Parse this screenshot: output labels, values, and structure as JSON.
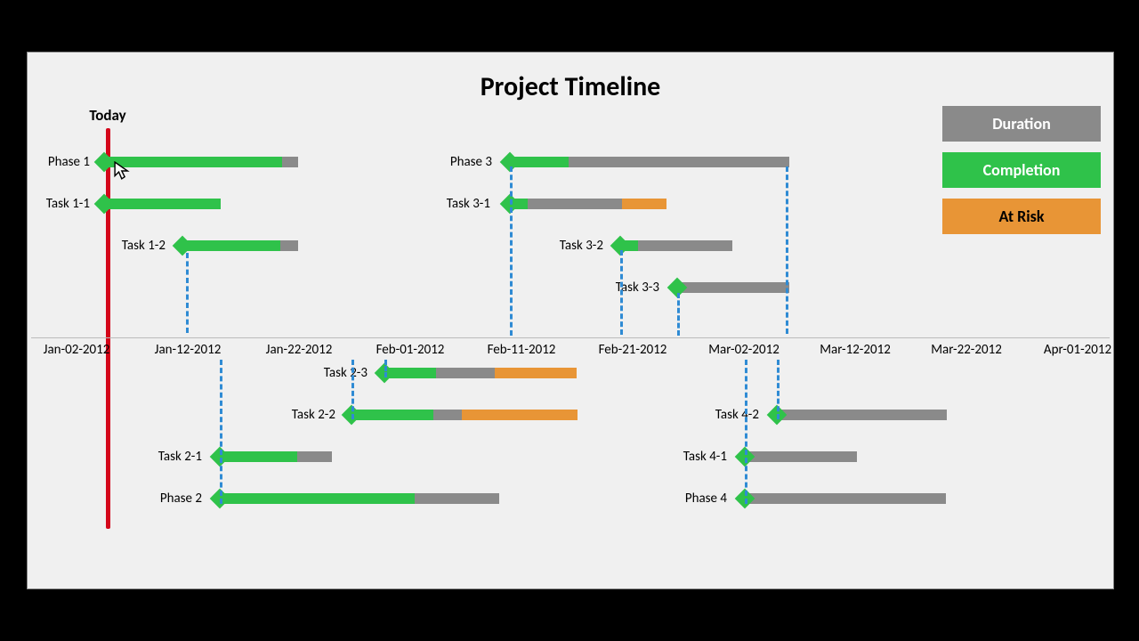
{
  "title": "Project Timeline",
  "today_label": "Today",
  "legend": {
    "duration": "Duration",
    "completion": "Completion",
    "risk": "At Risk"
  },
  "colors": {
    "duration": "#8a8a8a",
    "completion": "#2fc24a",
    "risk": "#e89536",
    "today": "#d4061a"
  },
  "chart_data": {
    "type": "gantt",
    "title": "Project Timeline",
    "x_axis": {
      "ticks": [
        "Jan-02-2012",
        "Jan-12-2012",
        "Jan-22-2012",
        "Feb-01-2012",
        "Feb-11-2012",
        "Feb-21-2012",
        "Mar-02-2012",
        "Mar-12-2012",
        "Mar-22-2012",
        "Apr-01-2012"
      ]
    },
    "today": "Jan-04-2012",
    "lanes": {
      "upper": [
        {
          "name": "Phase 1",
          "label": "Phase 1",
          "start": "Jan-04-2012",
          "end": "Jan-21-2012",
          "completion": 0.92,
          "risk": 0
        },
        {
          "name": "Task 1-1",
          "label": "Task 1-1",
          "start": "Jan-04-2012",
          "end": "Jan-14-2012",
          "completion": 1.0,
          "risk": 0
        },
        {
          "name": "Task 1-2",
          "label": "Task 1-2",
          "start": "Jan-11-2012",
          "end": "Jan-21-2012",
          "completion": 0.85,
          "risk": 0
        },
        {
          "name": "Phase 3",
          "label": "Phase 3",
          "start": "Feb-08-2012",
          "end": "Mar-04-2012",
          "completion": 0.22,
          "risk": 0
        },
        {
          "name": "Task 3-1",
          "label": "Task 3-1",
          "start": "Feb-08-2012",
          "end": "Feb-22-2012",
          "completion": 0.18,
          "risk": 0.82
        },
        {
          "name": "Task 3-2",
          "label": "Task 3-2",
          "start": "Feb-20-2012",
          "end": "Feb-29-2012",
          "completion": 0.18,
          "risk": 0
        },
        {
          "name": "Task 3-3",
          "label": "Task 3-3",
          "start": "Feb-25-2012",
          "end": "Mar-04-2012",
          "completion": 0,
          "risk": 0
        }
      ],
      "lower": [
        {
          "name": "Task 2-3",
          "label": "Task 2-3",
          "start": "Jan-29-2012",
          "end": "Feb-14-2012",
          "completion": 0.28,
          "risk": 0.72
        },
        {
          "name": "Task 2-2",
          "label": "Task 2-2",
          "start": "Jan-25-2012",
          "end": "Feb-14-2012",
          "completion": 0.35,
          "risk": 0.65
        },
        {
          "name": "Task 2-1",
          "label": "Task 2-1",
          "start": "Jan-14-2012",
          "end": "Jan-25-2012",
          "completion": 0.7,
          "risk": 0
        },
        {
          "name": "Phase 2",
          "label": "Phase 2",
          "start": "Jan-14-2012",
          "end": "Feb-08-2012",
          "completion": 0.7,
          "risk": 0
        },
        {
          "name": "Task 4-2",
          "label": "Task 4-2",
          "start": "Mar-04-2012",
          "end": "Mar-19-2012",
          "completion": 0,
          "risk": 0
        },
        {
          "name": "Task 4-1",
          "label": "Task 4-1",
          "start": "Mar-02-2012",
          "end": "Mar-12-2012",
          "completion": 0,
          "risk": 0
        },
        {
          "name": "Phase 4",
          "label": "Phase 4",
          "start": "Mar-02-2012",
          "end": "Mar-20-2012",
          "completion": 0,
          "risk": 0
        }
      ]
    },
    "dependencies": [
      {
        "from": "Task 1-2",
        "to": "Phase 2"
      },
      {
        "from": "Phase 2",
        "to": "Task 2-1"
      },
      {
        "from": "Task 2-2",
        "to": "Task 2-3"
      },
      {
        "from": "Task 2-3",
        "to": "Phase 3"
      },
      {
        "from": "Phase 3",
        "to": "Task 3-1"
      },
      {
        "from": "Task 3-2",
        "to": "Task 3-3"
      },
      {
        "from": "Task 3-3",
        "to": "Phase 4"
      },
      {
        "from": "Phase 4",
        "to": "Task 4-1"
      },
      {
        "from": "Task 4-1",
        "to": "Task 4-2"
      }
    ]
  }
}
